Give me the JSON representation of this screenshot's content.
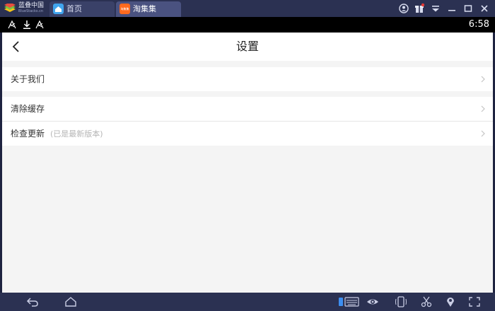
{
  "emulator": {
    "brand_name": "蓝叠中国",
    "brand_sub": "BlueStacks.cn",
    "tabs": [
      {
        "label": "首页",
        "icon": "home-icon"
      },
      {
        "label": "淘集集",
        "icon": "app-logo-icon",
        "icon_text": "淘集集"
      }
    ],
    "window_controls": [
      "account-icon",
      "gift-icon",
      "menu-icon",
      "minimize-icon",
      "maximize-icon",
      "close-icon"
    ],
    "bottom_icons": [
      "back-icon",
      "home-icon",
      "keyboard-icon",
      "eye-icon",
      "phone-rotate-icon",
      "scissors-icon",
      "location-icon",
      "fullscreen-icon"
    ]
  },
  "statusbar": {
    "time": "6:58",
    "icons": [
      "antenna-icon",
      "download-icon",
      "antenna-icon"
    ]
  },
  "app": {
    "title": "设置",
    "groups": [
      {
        "items": [
          {
            "label": "关于我们",
            "note": ""
          }
        ]
      },
      {
        "items": [
          {
            "label": "清除缓存",
            "note": ""
          },
          {
            "label": "检查更新",
            "note": "(已是最新版本)"
          }
        ]
      }
    ]
  },
  "colors": {
    "emulator_frame": "#2b3152",
    "accent_orange": "#ff6a1e",
    "accent_blue": "#41a5ee",
    "screen_bg": "#f4f4f4"
  }
}
